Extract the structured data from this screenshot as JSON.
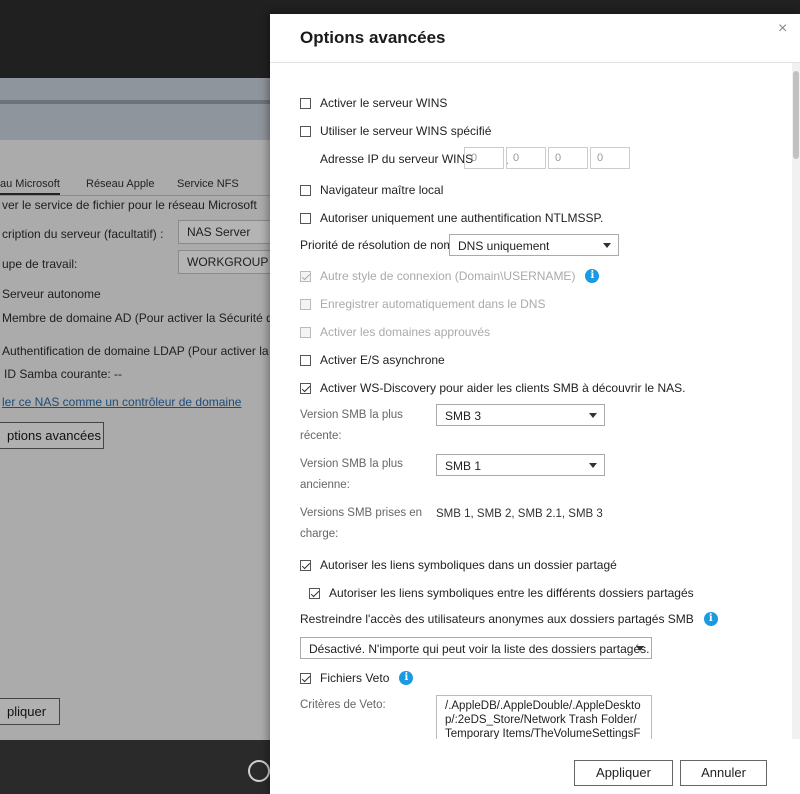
{
  "background": {
    "tabs": [
      {
        "label": "au Microsoft",
        "active": true
      },
      {
        "label": "Réseau Apple",
        "active": false
      },
      {
        "label": "Service NFS",
        "active": false
      }
    ],
    "enable_text": "ver le service de fichier pour le réseau Microsoft",
    "description_label": "cription du serveur (facultatif) :",
    "description_value": "NAS Server",
    "workgroup_label": "upe de travail:",
    "workgroup_value": "WORKGROUP",
    "standalone": "Serveur autonome",
    "ad_member": "Membre de domaine AD (Pour activer la Sécurité de dom",
    "ldap_auth": "Authentification de domaine LDAP (Pour activer la Sécur",
    "samba_id": "ID Samba courante: --",
    "dc_link": "ler ce NAS comme un contrôleur de domaine",
    "advanced_button": "ptions avancées",
    "apply_button": "pliquer"
  },
  "modal": {
    "title": "Options avancées",
    "close_glyph": "×",
    "wins_server": {
      "label": "Activer le serveur WINS",
      "checked": false
    },
    "wins_specified": {
      "label": "Utiliser le serveur WINS spécifié",
      "checked": false
    },
    "wins_ip": {
      "label": "Adresse IP du serveur WINS",
      "octets": [
        "0",
        "0",
        "0",
        "0"
      ]
    },
    "local_master": {
      "label": "Navigateur maître local",
      "checked": false
    },
    "ntlmssp": {
      "label": "Autoriser uniquement une authentification NTLMSSP.",
      "checked": false
    },
    "name_resolution": {
      "label": "Priorité de résolution de nom:",
      "value": "DNS uniquement"
    },
    "login_style": {
      "label": "Autre style de connexion (Domain\\USERNAME)",
      "checked": true,
      "disabled": true
    },
    "dns_register": {
      "label": "Enregistrer automatiquement dans le DNS",
      "checked": false,
      "disabled": true
    },
    "trusted_domains": {
      "label": "Activer les domaines approuvés",
      "checked": false,
      "disabled": true
    },
    "async_io": {
      "label": "Activer E/S asynchrone",
      "checked": false
    },
    "ws_discovery": {
      "label": "Activer WS-Discovery pour aider les clients SMB à découvrir le NAS.",
      "checked": true
    },
    "smb_max": {
      "label_line1": "Version SMB la plus",
      "label_line2": "récente:",
      "value": "SMB 3"
    },
    "smb_min": {
      "label_line1": "Version SMB la plus",
      "label_line2": "ancienne:",
      "value": "SMB 1"
    },
    "smb_supported": {
      "label_line1": "Versions SMB prises en",
      "label_line2": "charge:",
      "value": "SMB 1, SMB 2, SMB 2.1, SMB 3"
    },
    "symlinks_share": {
      "label": "Autoriser les liens symboliques dans un dossier partagé",
      "checked": true
    },
    "symlinks_cross": {
      "label": "Autoriser les liens symboliques entre les différents dossiers partagés",
      "checked": true
    },
    "anon_restrict": {
      "label": "Restreindre l'accès des utilisateurs anonymes aux dossiers partagés SMB",
      "value": "Désactivé. N'importe qui peut voir la liste des dossiers partagés. Le"
    },
    "veto_files": {
      "label": "Fichiers Veto",
      "checked": true
    },
    "veto_criteria": {
      "label": "Critères de Veto:",
      "value": "/.AppleDB/.AppleDouble/.AppleDesktop/:2eDS_Store/Network Trash Folder/Temporary Items/TheVolumeSettingsFolder/.@__th"
    },
    "apply_button": "Appliquer",
    "cancel_button": "Annuler",
    "info_glyph": "i"
  }
}
